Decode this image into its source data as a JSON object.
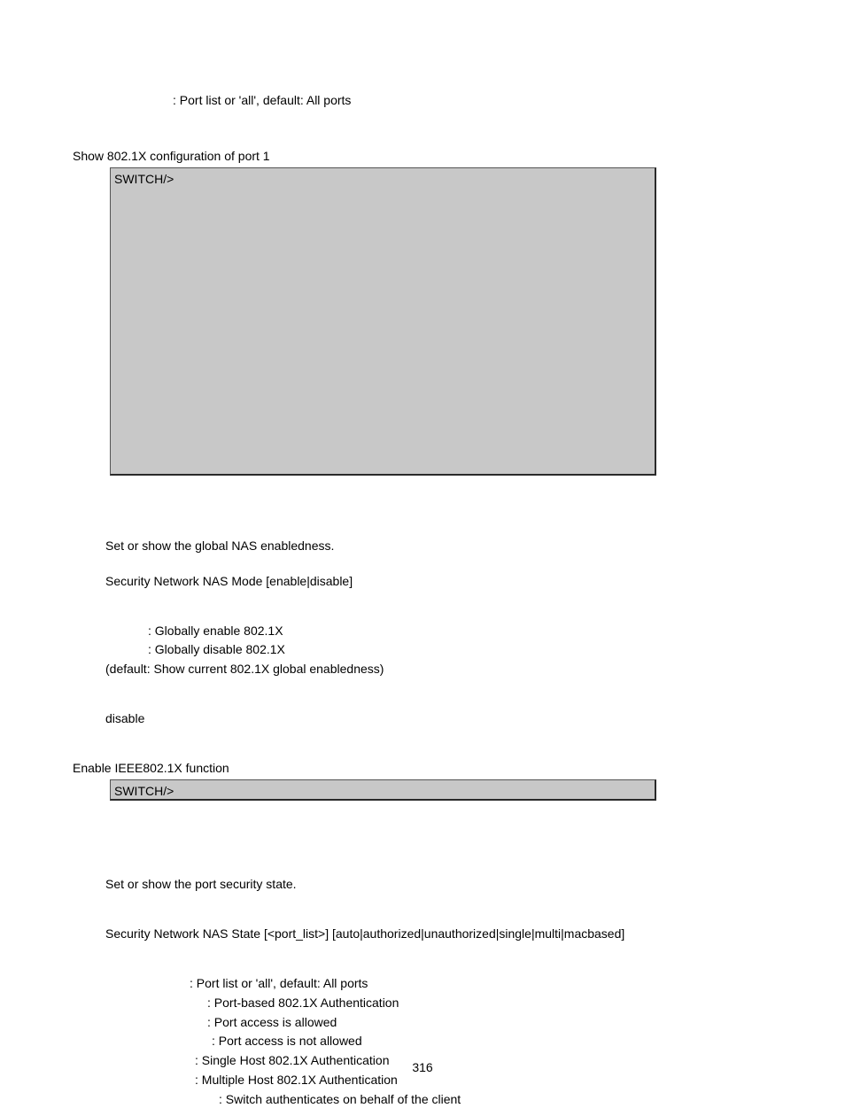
{
  "top": {
    "port_list_desc": ": Port list or 'all', default: All ports",
    "example_heading": "Show 802.1X configuration of port 1"
  },
  "terminal1": {
    "prompt": "SWITCH/>"
  },
  "mode": {
    "desc": "Set or show the global NAS enabledness.",
    "syntax": "Security Network NAS Mode [enable|disable]",
    "param_enable": ": Globally enable 802.1X",
    "param_disable": ": Globally disable 802.1X",
    "param_default": "(default: Show current 802.1X global enabledness)",
    "default_value": "disable",
    "example_heading": "Enable IEEE802.1X function"
  },
  "terminal2": {
    "prompt": "SWITCH/>"
  },
  "state": {
    "desc": "Set or show the port security state.",
    "syntax": "Security Network NAS State [<port_list>] [auto|authorized|unauthorized|single|multi|macbased]",
    "param_port_list": ": Port list or 'all', default: All ports",
    "param_auto": ": Port-based 802.1X Authentication",
    "param_authorized": ": Port access is allowed",
    "param_unauthorized": ": Port access is not allowed",
    "param_single": ": Single Host 802.1X Authentication",
    "param_multi": ": Multiple Host 802.1X Authentication",
    "param_macbased": ": Switch authenticates on behalf of the client"
  },
  "page_number": "316"
}
